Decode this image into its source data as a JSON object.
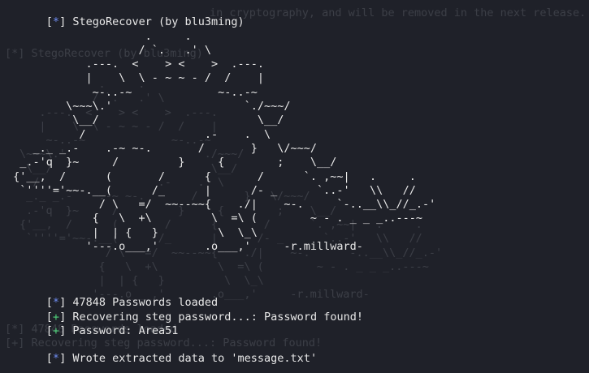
{
  "colors": {
    "background": "#1f2129",
    "text": "#e8e8e8",
    "info_symbol": "#6f8df2",
    "success_symbol": "#4fd17a"
  },
  "ghost": {
    "warning_line": "in cryptography, and will be removed in the next release.",
    "title_line": "[*] StegoRecover (by blu3ming)",
    "art": "            .     .\n           / `.   .' \\\n   .---.  <    > <    >  .---.\n   |    \\  \\ - ~ ~ - /  /    |\n    ~-..-~             ~-..-~\n\\~~~\\.'                    `./~~~/\n \\__/                        \\__/\n  /                  .-    .  \\\n _._ _.-    .-~ ~-.       /       }   \\/~~~/\n .-'q  }~     /         }     {        ;    \\__/\n{'__,  /      (       /      {       /      `. ,~~|   .     .\n `''''='~~-.__(      /_      |      /- _      `..-'   \\\\   //\n             / \\   =/  ~~--~~{    ./|    ~-.     `-..__\\\\_//_.-'\n            {   \\  +\\         \\  =\\ (        ~ - . _ _ _..---~\n            |  | {   }         \\  \\_\\\n           '---.o___,'       .o___,'     -r.millward-",
    "lines_bottom": [
      "[*] 47848 Passwords loaded",
      "[+] Recovering steg password...: Password found!"
    ]
  },
  "terminal": {
    "title": {
      "symbol": "*",
      "text": "StegoRecover (by blu3ming)"
    },
    "art": "                     .     .\n                    / `.   .' \\\n            .---.  <    > <    >  .---.\n            |    \\  \\ - ~ ~ - /  /    |\n             ~-..-~             ~-..-~\n         \\~~~\\.'                    `./~~~/\n          \\__/                        \\__/\n           /                  .-    .  \\\n    _._ _.-    .-~ ~-.       /       }   \\/~~~/\n  _.-'q  }~     /         }     {        ;    \\__/\n {'__,  /      (       /      {       /      `. ,~~|   .     .\n  `''''='~~-.__(      /_      |      /- _      `..-'   \\\\   //\n              / \\   =/  ~~--~~{    ./|    ~-.     `-..__\\\\_//_.-'\n             {   \\  +\\         \\  =\\ (        ~ - . _ _ _..---~\n             |  | {   }         \\  \\_\\\n            '---.o___,'       .o___,'     -r.millward-",
    "output_lines": [
      {
        "symbol": "*",
        "kind": "info",
        "text": "47848 Passwords loaded"
      },
      {
        "symbol": "+",
        "kind": "ok",
        "text": "Recovering steg password...: Password found!"
      },
      {
        "symbol": "+",
        "kind": "ok",
        "text": "Password: Area51"
      }
    ],
    "final_line": {
      "symbol": "*",
      "kind": "info",
      "text": "Wrote extracted data to 'message.txt'"
    }
  }
}
